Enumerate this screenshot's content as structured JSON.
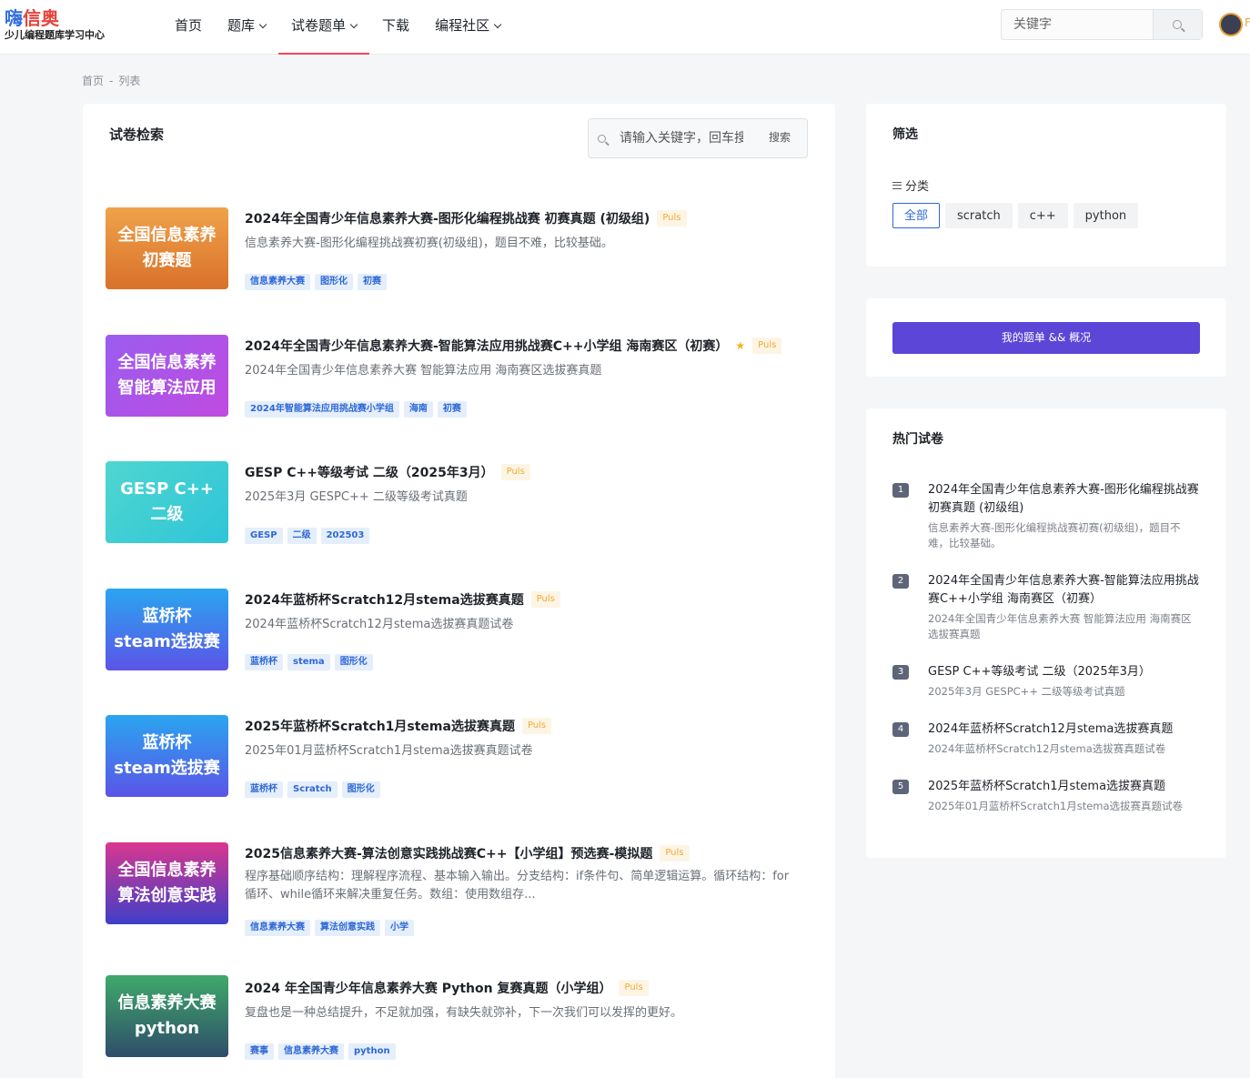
{
  "header": {
    "logo_main_a": "嗨",
    "logo_main_b": "信奥",
    "logo_sub": "少儿编程题库学习中心",
    "nav": [
      {
        "label": "首页"
      },
      {
        "label": "题库"
      },
      {
        "label": "试卷题单"
      },
      {
        "label": "下载"
      },
      {
        "label": "编程社区"
      }
    ],
    "search_value": "关键字",
    "avatar_letter": "F"
  },
  "breadcrumb": {
    "home": "首页",
    "sep": "-",
    "current": "列表"
  },
  "main": {
    "title": "试卷检索",
    "search_placeholder": "请输入关键字，回车搜索",
    "search_button": "搜索",
    "items": [
      {
        "thumb_lines": [
          "全国信息素养",
          "初赛题"
        ],
        "title": "2024年全国青少年信息素养大赛-图形化编程挑战赛 初赛真题 (初级组)",
        "badge": "Puls",
        "desc": "信息素养大赛-图形化编程挑战赛初赛(初级组)，题目不难，比较基础。",
        "tags": [
          "信息素养大赛",
          "图形化",
          "初赛"
        ]
      },
      {
        "thumb_lines": [
          "全国信息素养",
          "智能算法应用"
        ],
        "title": "2024年全国青少年信息素养大赛-智能算法应用挑战赛C++小学组 海南赛区（初赛）",
        "star": "★",
        "badge": "Puls",
        "desc": "2024年全国青少年信息素养大赛 智能算法应用 海南赛区选拔赛真题",
        "tags": [
          "2024年智能算法应用挑战赛小学组",
          "海南",
          "初赛"
        ]
      },
      {
        "thumb_lines": [
          "GESP  C++",
          "二级"
        ],
        "title": "GESP C++等级考试 二级（2025年3月）",
        "badge": "Puls",
        "desc": "2025年3月 GESPC++ 二级等级考试真题",
        "tags": [
          "GESP",
          "二级",
          "202503"
        ]
      },
      {
        "thumb_lines": [
          "蓝桥杯",
          "steam选拔赛"
        ],
        "title": "2024年蓝桥杯Scratch12月stema选拔赛真题",
        "badge": "Puls",
        "desc": "2024年蓝桥杯Scratch12月stema选拔赛真题试卷",
        "tags": [
          "蓝桥杯",
          "stema",
          "图形化"
        ]
      },
      {
        "thumb_lines": [
          "蓝桥杯",
          "steam选拔赛"
        ],
        "title": "2025年蓝桥杯Scratch1月stema选拔赛真题",
        "badge": "Puls",
        "desc": "2025年01月蓝桥杯Scratch1月stema选拔赛真题试卷",
        "tags": [
          "蓝桥杯",
          "Scratch",
          "图形化"
        ]
      },
      {
        "thumb_lines": [
          "全国信息素养",
          "算法创意实践"
        ],
        "title": "2025信息素养大赛-算法创意实践挑战赛C++【小学组】预选赛-模拟题",
        "badge": "Puls",
        "desc": "程序基础顺序结构：理解程序流程、基本输入输出。分支结构：if条件句、简单逻辑运算。循环结构：for循环、while循环来解决重复任务。数组：使用数组存...",
        "tags": [
          "信息素养大赛",
          "算法创意实践",
          "小学"
        ]
      },
      {
        "thumb_lines": [
          "信息素养大赛",
          "python"
        ],
        "title": "2024 年全国青少年信息素养大赛 Python 复赛真题（小学组）",
        "badge": "Puls",
        "desc": "复盘也是一种总结提升，不足就加强，有缺失就弥补，下一次我们可以发挥的更好。",
        "tags": [
          "赛事",
          "信息素养大赛",
          "python"
        ]
      }
    ]
  },
  "filter": {
    "title": "筛选",
    "category_label": "分类",
    "options": [
      "全部",
      "scratch",
      "c++",
      "python"
    ],
    "selected": "全部"
  },
  "overview_button": "我的题单 && 概况",
  "hot": {
    "title": "热门试卷",
    "items": [
      {
        "num": "1",
        "title": "2024年全国青少年信息素养大赛-图形化编程挑战赛 初赛真题 (初级组)",
        "desc": "信息素养大赛-图形化编程挑战赛初赛(初级组)，题目不难，比较基础。"
      },
      {
        "num": "2",
        "title": "2024年全国青少年信息素养大赛-智能算法应用挑战赛C++小学组 海南赛区（初赛）",
        "desc": "2024年全国青少年信息素养大赛 智能算法应用 海南赛区选拔赛真题"
      },
      {
        "num": "3",
        "title": "GESP C++等级考试 二级（2025年3月）",
        "desc": "2025年3月 GESPC++ 二级等级考试真题"
      },
      {
        "num": "4",
        "title": "2024年蓝桥杯Scratch12月stema选拔赛真题",
        "desc": "2024年蓝桥杯Scratch12月stema选拔赛真题试卷"
      },
      {
        "num": "5",
        "title": "2025年蓝桥杯Scratch1月stema选拔赛真题",
        "desc": "2025年01月蓝桥杯Scratch1月stema选拔赛真题试卷"
      }
    ]
  },
  "colors": {
    "accent_nav": "#ef4b5a",
    "primary_button": "#5b46d8",
    "tag_text": "#2e68d6",
    "badge_text": "#f2a73b"
  }
}
